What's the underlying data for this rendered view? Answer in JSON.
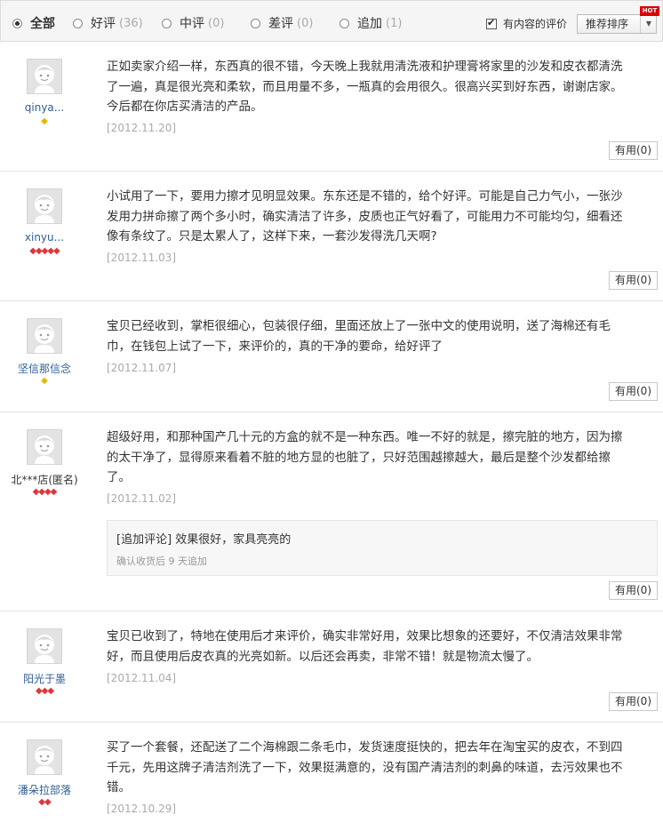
{
  "filter": {
    "options": [
      {
        "label": "全部",
        "count": ""
      },
      {
        "label": "好评",
        "count": "(36)"
      },
      {
        "label": "中评",
        "count": "(0)"
      },
      {
        "label": "差评",
        "count": "(0)"
      },
      {
        "label": "追加",
        "count": "(1)"
      }
    ],
    "only_with_content": "有内容的评价",
    "sort_label": "推荐排序",
    "hot_badge": "HOT"
  },
  "reviews": [
    {
      "user": "qinya...",
      "level_icons": "◆",
      "content": "正如卖家介绍一样，东西真的很不错，今天晚上我就用清洗液和护理膏将家里的沙发和皮衣都清洗了一遍，真是很光亮和柔软，而且用量不多，一瓶真的会用很久。很高兴买到好东西，谢谢店家。今后都在你店买清洁的产品。",
      "date": "[2012.11.20]",
      "useful_label": "有用",
      "useful_count": "(0)"
    },
    {
      "user": "xinyu...",
      "level_icons": "◆◆◆◆◆",
      "content": "小试用了一下，要用力擦才见明显效果。东东还是不错的，给个好评。可能是自己力气小，一张沙发用力拼命擦了两个多小时，确实清洁了许多，皮质也正气好看了，可能用力不可能均匀，细看还像有条纹了。只是太累人了，这样下来，一套沙发得洗几天啊?",
      "date": "[2012.11.03]",
      "useful_label": "有用",
      "useful_count": "(0)"
    },
    {
      "user": "坚信那信念",
      "level_icons": "◆",
      "content": "宝贝已经收到，掌柜很细心，包装很仔细，里面还放上了一张中文的使用说明，送了海棉还有毛巾，在钱包上试了一下，来评价的，真的干净的要命，给好评了",
      "date": "[2012.11.07]",
      "useful_label": "有用",
      "useful_count": "(0)"
    },
    {
      "user": "北***店(匿名)",
      "level_icons": "◆◆◆◆",
      "content": "超级好用，和那种国产几十元的方盒的就不是一种东西。唯一不好的就是，擦完脏的地方，因为擦的太干净了，显得原来看着不脏的地方显的也脏了，只好范围越擦越大，最后是整个沙发都给擦了。",
      "date": "[2012.11.02]",
      "append_text": "[追加评论] 效果很好，家具亮亮的",
      "append_sub": "确认收货后 9 天追加",
      "useful_label": "有用",
      "useful_count": "(0)"
    },
    {
      "user": "阳光于墨",
      "level_icons": "◆◆◆",
      "content": "宝贝已收到了，特地在使用后才来评价，确实非常好用，效果比想象的还要好，不仅清洁效果非常好，而且使用后皮衣真的光亮如新。以后还会再卖，非常不错！就是物流太慢了。",
      "date": "[2012.11.04]",
      "useful_label": "有用",
      "useful_count": "(0)"
    },
    {
      "user": "潘朵拉部落",
      "level_icons": "◆◆",
      "content": "买了一个套餐，还配送了二个海棉跟二条毛巾，发货速度挺快的，把去年在淘宝买的皮衣，不到四千元，先用这牌子清洁剂洗了一下，效果挺满意的，没有国产清洁剂的刺鼻的味道，去污效果也不错。",
      "date": "[2012.10.29]"
    }
  ]
}
